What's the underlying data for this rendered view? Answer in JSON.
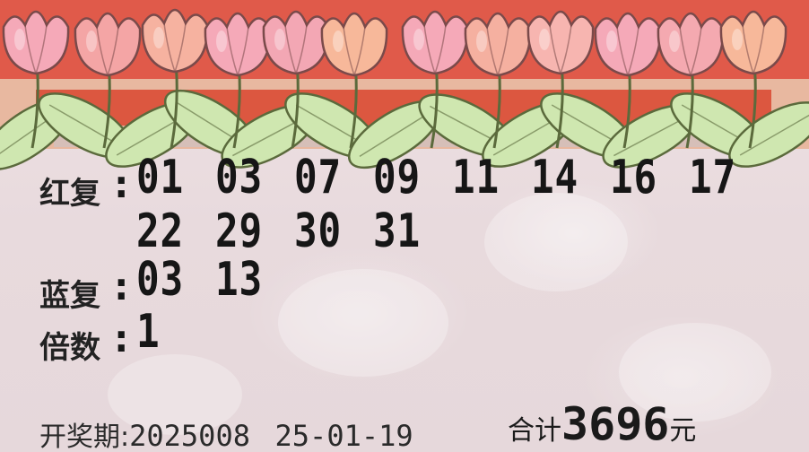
{
  "ticket": {
    "red_compound": {
      "label": "红复",
      "numbers": [
        "01",
        "03",
        "07",
        "09",
        "11",
        "14",
        "16",
        "17",
        "22",
        "29",
        "30",
        "31"
      ]
    },
    "blue_compound": {
      "label": "蓝复",
      "numbers": [
        "03",
        "13"
      ]
    },
    "multiplier": {
      "label": "倍数",
      "value": "1"
    },
    "draw": {
      "label": "开奖期",
      "period": "2025008",
      "date": "25-01-19"
    },
    "total": {
      "label": "合计",
      "amount": "3696",
      "unit": "元"
    }
  },
  "colors": {
    "paper": "#e9dfe1",
    "ink": "#161616",
    "header_red": "#d83a2a",
    "tulip_pink": "#f5a9b8",
    "tulip_peach": "#f7b89a",
    "leaf_green": "#cfe7b0",
    "leaf_outline": "#5b6a3c"
  },
  "decoration": {
    "overlay": "tulip-border"
  }
}
